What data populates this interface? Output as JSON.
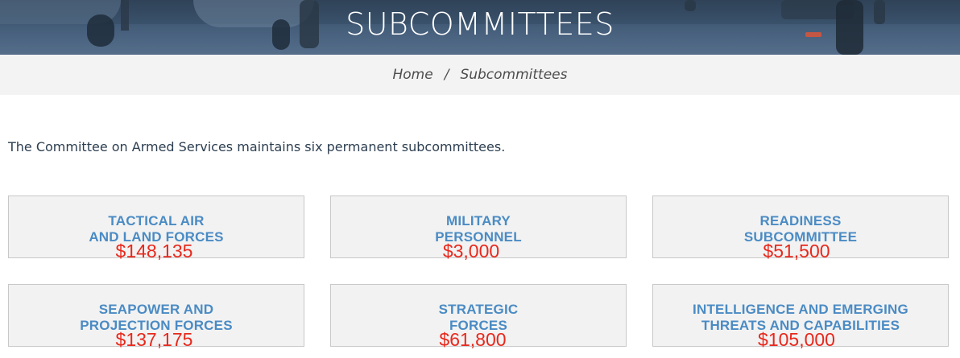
{
  "page": {
    "title": "SUBCOMMITTEES",
    "breadcrumb": {
      "home": "Home",
      "separator": "/",
      "current": "Subcommittees"
    },
    "intro": "The Committee on Armed Services maintains six permanent subcommittees."
  },
  "subcommittees": [
    {
      "line1": "TACTICAL AIR",
      "line2": "AND LAND FORCES",
      "amount": "$148,135"
    },
    {
      "line1": "MILITARY",
      "line2": "PERSONNEL",
      "amount": "$3,000"
    },
    {
      "line1": "READINESS",
      "line2": "SUBCOMMITTEE",
      "amount": "$51,500"
    },
    {
      "line1": "SEAPOWER AND",
      "line2": "PROJECTION FORCES",
      "amount": "$137,175"
    },
    {
      "line1": "STRATEGIC",
      "line2": "FORCES",
      "amount": "$61,800"
    },
    {
      "line1": "INTELLIGENCE AND EMERGING",
      "line2": "THREATS AND CAPABILITIES",
      "amount": "$105,000"
    }
  ],
  "colors": {
    "title_text": "#ffffff",
    "subcommittee_name": "#4a8bc4",
    "amount": "#e8281c",
    "card_background": "#f2f2f2",
    "breadcrumb_background": "#f3f3f3"
  }
}
